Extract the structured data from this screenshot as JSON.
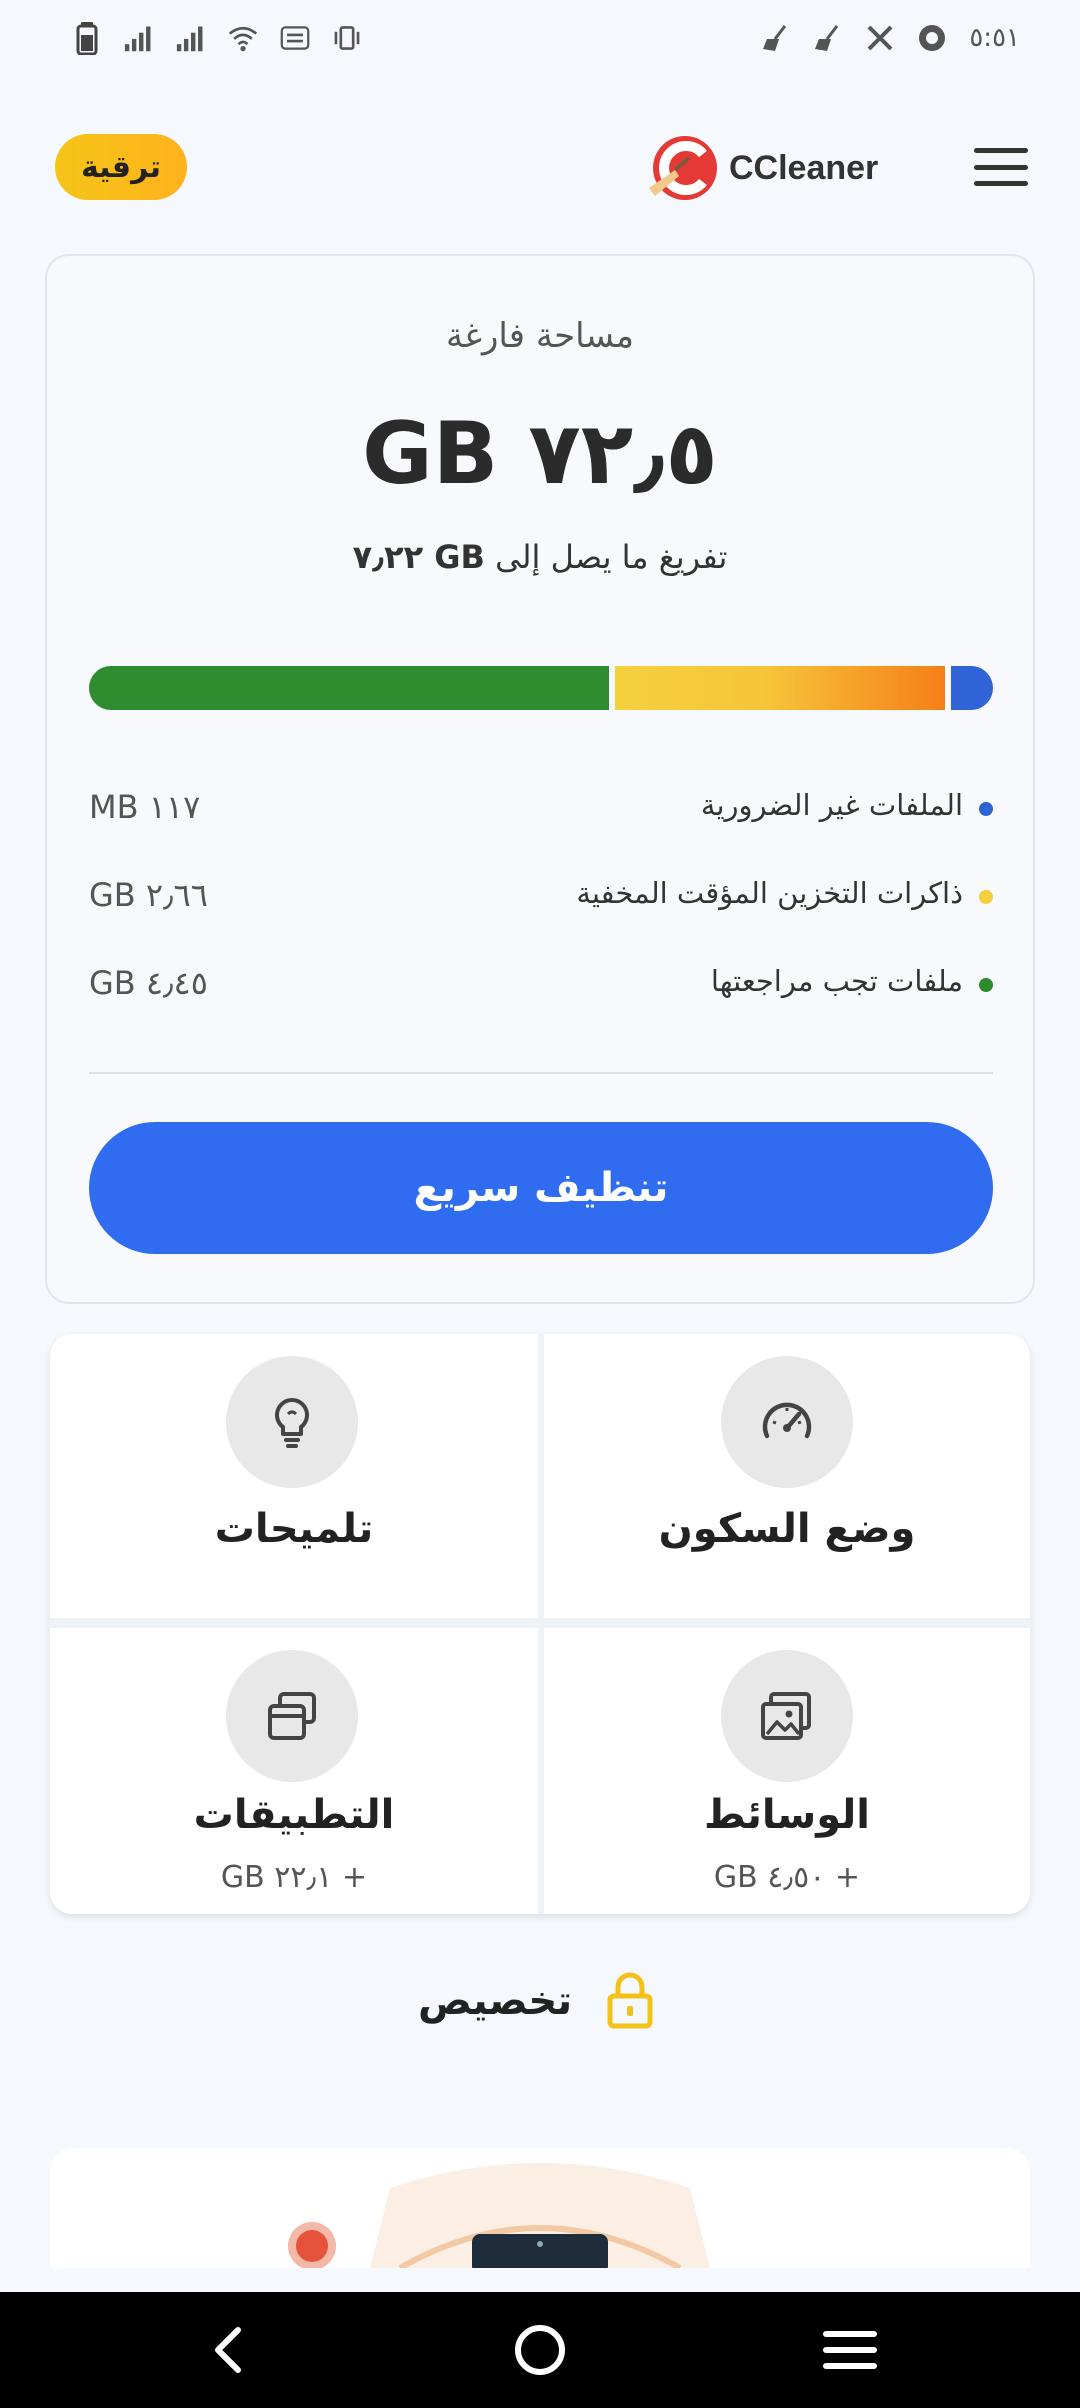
{
  "status_bar": {
    "time": "٥:٥١"
  },
  "header": {
    "upgrade_label": "ترقية",
    "brand_name": "CCleaner"
  },
  "storage": {
    "free_label": "مساحة فارغة",
    "free_value": "GB ٧٢٫٥",
    "free_up_prefix": "تفريغ ما يصل إلى",
    "free_up_value": "GB ٧٫٢٢",
    "bar": {
      "green_color": "#2e8b2e",
      "yellow_color": "#f4d03f",
      "blue_color": "#2f63d6"
    },
    "legend": [
      {
        "label": "الملفات غير الضرورية",
        "value": "MB ١١٧",
        "color": "#2f63d6"
      },
      {
        "label": "ذاكرات التخزين المؤقت المخفية",
        "value": "GB ٢٫٦٦",
        "color": "#f4d03f"
      },
      {
        "label": "ملفات تجب مراجعتها",
        "value": "GB ٤٫٤٥",
        "color": "#2e8b2e"
      }
    ],
    "quick_clean_label": "تنظيف سريع"
  },
  "tiles": {
    "sleep_mode": {
      "title": "وضع السكون",
      "icon": "speedometer-icon"
    },
    "tips": {
      "title": "تلميحات",
      "icon": "lightbulb-icon"
    },
    "media": {
      "title": "الوسائط",
      "sub": "GB ٤٫٥٠ +",
      "icon": "images-icon"
    },
    "apps": {
      "title": "التطبيقات",
      "sub": "GB ٢٢٫١ +",
      "icon": "apps-stack-icon"
    }
  },
  "customize": {
    "label": "تخصيص",
    "icon": "lock-icon"
  },
  "nav": {
    "back_icon": "back-chevron-icon",
    "home_icon": "home-circle-icon",
    "recents_icon": "recents-menu-icon"
  }
}
